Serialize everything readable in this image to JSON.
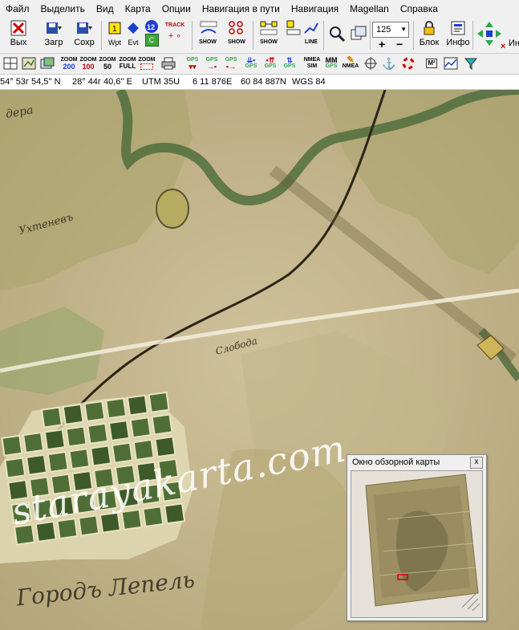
{
  "menu": [
    "Файл",
    "Выделить",
    "Вид",
    "Карта",
    "Опции",
    "Навигация в пути",
    "Навигация",
    "Magellan",
    "Справка"
  ],
  "toolbar": {
    "exit_label": "Вых",
    "load_label": "Загр",
    "save_label": "Сохр",
    "wpt_label": "Wpt",
    "evt_label": "Evt",
    "badge_12": "12",
    "badge_c": "C",
    "track_label": "TRACK",
    "show_label": "SHOW",
    "show2_label": "SHOW",
    "show3_label": "SHOW",
    "line_label": "LINE",
    "scale_value": "125",
    "block_label": "Блок",
    "info_label": "Инфо",
    "cut_label": "Ин"
  },
  "toolbar2": {
    "zoom200_top": "ZOOM",
    "zoom200_bot": "200",
    "zoom100_top": "ZOOM",
    "zoom100_bot": "100",
    "zoom50_top": "ZOOM",
    "zoom50_bot": "50",
    "zoomfull_top": "ZOOM",
    "zoomfull_bot": "FULL",
    "zoomsel_top": "ZOOM",
    "gps": "GPS",
    "nmea_top": "NMEA",
    "nmea_bot": "SIM",
    "mm_top": "MM",
    "mm_bot": "GPS",
    "nmea2": "NMEA",
    "m2": "M²"
  },
  "status": {
    "lat": "54° 53г 54,5'' N",
    "lon": "28° 44г 40,6'' E",
    "utm": "UTM  35U",
    "east": "6 11 876E",
    "north": "60 84 887N",
    "datum": "WGS 84"
  },
  "map": {
    "watermark": "starayakarta.com",
    "town_label": "Городъ Лепель"
  },
  "overview": {
    "title": "Окно обзорной карты",
    "close": "x"
  }
}
